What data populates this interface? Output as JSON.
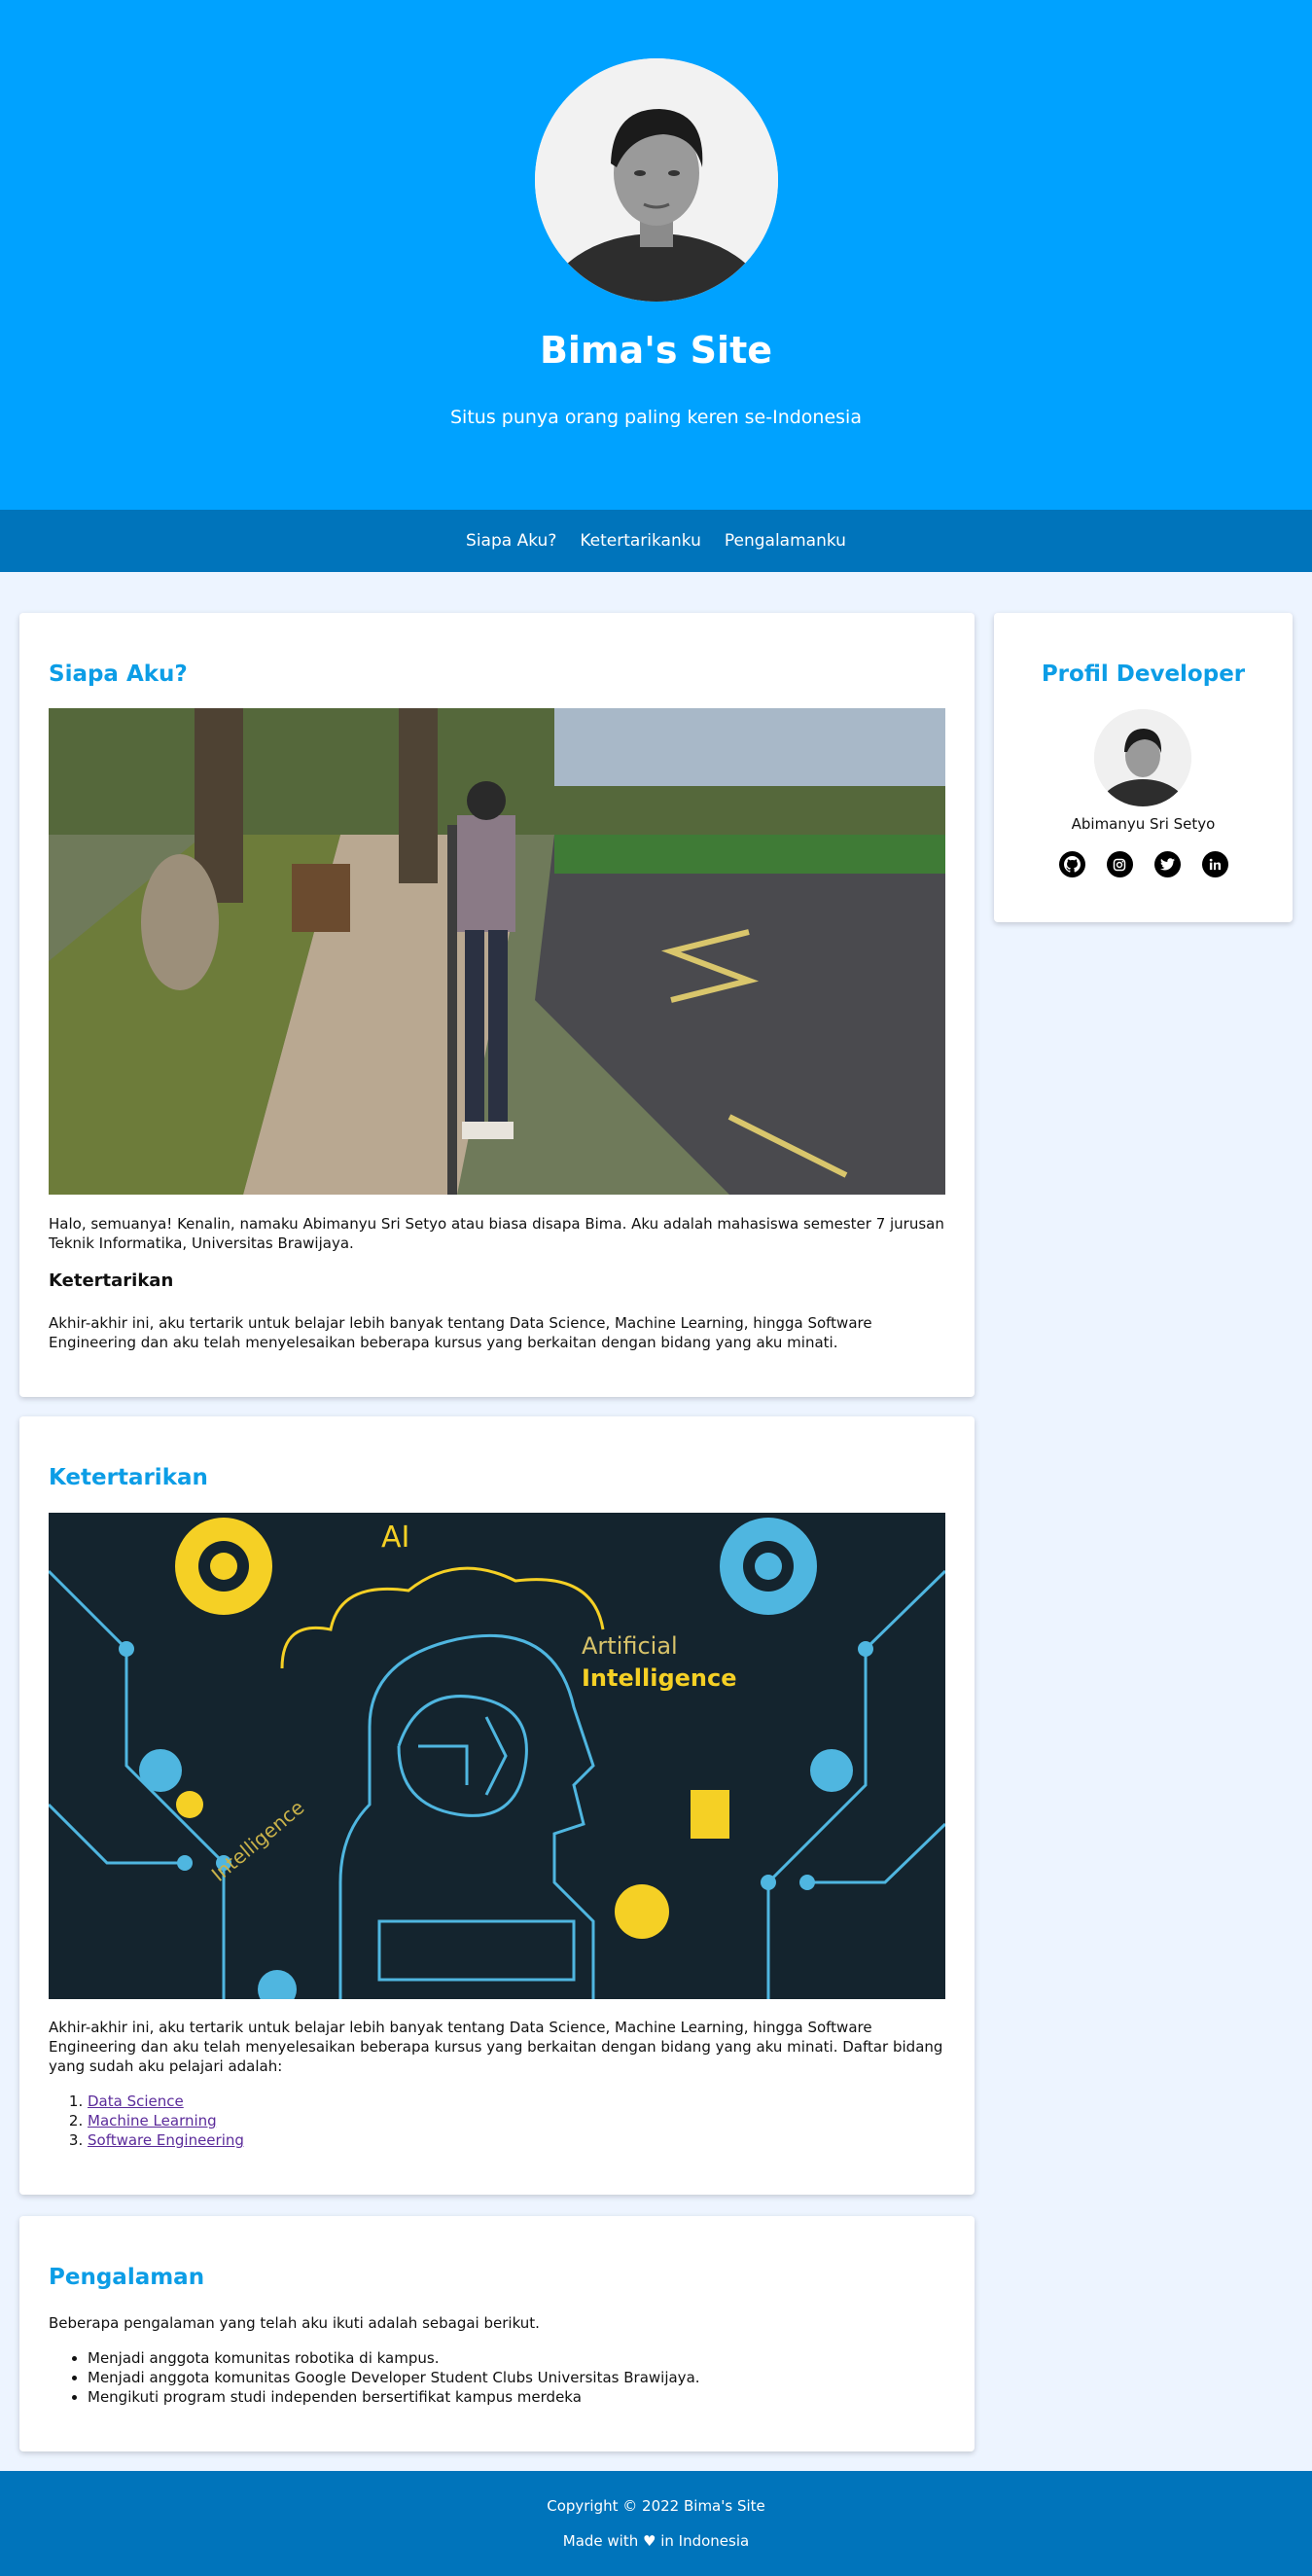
{
  "header": {
    "title": "Bima's Site",
    "subtitle": "Situs punya orang paling keren se-Indonesia",
    "avatar_icon": "person-avatar-photo"
  },
  "nav": {
    "items": [
      {
        "label": "Siapa Aku?"
      },
      {
        "label": "Ketertarikanku"
      },
      {
        "label": "Pengalamanku"
      }
    ]
  },
  "about": {
    "heading": "Siapa Aku?",
    "image": "photo-person-on-sidewalk",
    "intro": "Halo, semuanya! Kenalin, namaku Abimanyu Sri Setyo atau biasa disapa Bima. Aku adalah mahasiswa semester 7 jurusan Teknik Informatika, Universitas Brawijaya.",
    "subheading": "Ketertarikan",
    "interest_text": "Akhir-akhir ini, aku tertarik untuk belajar lebih banyak tentang Data Science, Machine Learning, hingga Software Engineering dan aku telah menyelesaikan beberapa kursus yang berkaitan dengan bidang yang aku minati."
  },
  "interests": {
    "heading": "Ketertarikan",
    "image": "artificial-intelligence-illustration",
    "image_text": {
      "ai": "AI",
      "artificial": "Artificial",
      "intelligence": "Intelligence",
      "intelligence_small": "Intelligence"
    },
    "text": "Akhir-akhir ini, aku tertarik untuk belajar lebih banyak tentang Data Science, Machine Learning, hingga Software Engineering dan aku telah menyelesaikan beberapa kursus yang berkaitan dengan bidang yang aku minati. Daftar bidang yang sudah aku pelajari adalah:",
    "list": [
      "Data Science",
      "Machine Learning",
      "Software Engineering"
    ]
  },
  "experience": {
    "heading": "Pengalaman",
    "text": "Beberapa pengalaman yang telah aku ikuti adalah sebagai berikut.",
    "list": [
      "Menjadi anggota komunitas robotika di kampus.",
      "Menjadi anggota komunitas Google Developer Student Clubs Universitas Brawijaya.",
      "Mengikuti program studi independen bersertifikat kampus merdeka"
    ]
  },
  "profile": {
    "heading": "Profil Developer",
    "name": "Abimanyu Sri Setyo",
    "socials": [
      {
        "icon": "github-icon"
      },
      {
        "icon": "instagram-icon"
      },
      {
        "icon": "twitter-icon"
      },
      {
        "icon": "linkedin-icon"
      }
    ]
  },
  "footer": {
    "copyright": "Copyright © 2022 Bima's Site",
    "made_with": "Made with ♥ in Indonesia"
  },
  "colors": {
    "hero": "#00a2ff",
    "nav": "#0074bb",
    "accent": "#0c9de6",
    "background": "#edf4ff"
  }
}
